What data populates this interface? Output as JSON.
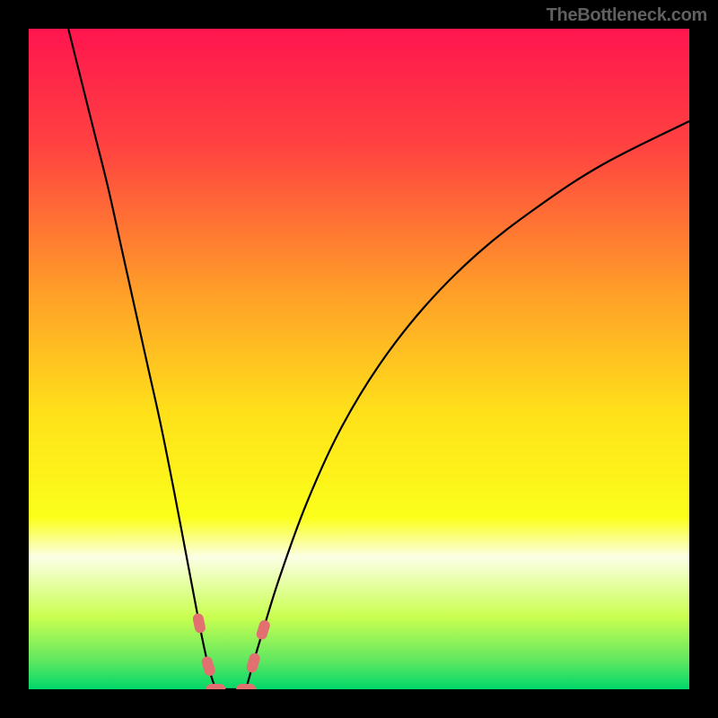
{
  "watermark": "TheBottleneck.com",
  "chart_data": {
    "type": "line",
    "title": "",
    "xlabel": "",
    "ylabel": "",
    "xlim": [
      0,
      100
    ],
    "ylim": [
      0,
      100
    ],
    "background_gradient": {
      "stops": [
        {
          "offset": 0.0,
          "color": "#ff154f"
        },
        {
          "offset": 0.18,
          "color": "#ff4340"
        },
        {
          "offset": 0.4,
          "color": "#ff9f28"
        },
        {
          "offset": 0.58,
          "color": "#ffe01a"
        },
        {
          "offset": 0.74,
          "color": "#fbff1a"
        },
        {
          "offset": 0.8,
          "color": "#fbffe5"
        },
        {
          "offset": 0.89,
          "color": "#caff50"
        },
        {
          "offset": 0.955,
          "color": "#63e860"
        },
        {
          "offset": 1.0,
          "color": "#00d86a"
        }
      ]
    },
    "series": [
      {
        "name": "left-curve",
        "x": [
          6,
          8,
          10,
          12,
          14,
          16,
          18,
          20,
          22,
          24,
          25.8,
          27.2,
          28.3
        ],
        "y": [
          100,
          92,
          84,
          76,
          67,
          58,
          49,
          40,
          30,
          19.5,
          10,
          3.5,
          0
        ]
      },
      {
        "name": "right-curve",
        "x": [
          32.9,
          34,
          35.5,
          38,
          42,
          47,
          53,
          60,
          68,
          77,
          87,
          100
        ],
        "y": [
          0,
          4,
          9,
          17,
          28,
          39,
          49,
          58,
          66,
          73,
          79.5,
          86
        ]
      }
    ],
    "flat_segment": {
      "x0": 28.3,
      "x1": 32.9,
      "y": 0
    },
    "markers": [
      {
        "name": "marker-left-upper",
        "x": 25.8,
        "y": 10.0
      },
      {
        "name": "marker-left-lower",
        "x": 27.2,
        "y": 3.5
      },
      {
        "name": "marker-bottom-left",
        "x": 28.3,
        "y": 0.0
      },
      {
        "name": "marker-bottom-right",
        "x": 32.9,
        "y": 0.0
      },
      {
        "name": "marker-right-lower",
        "x": 34.0,
        "y": 4.0
      },
      {
        "name": "marker-right-upper",
        "x": 35.5,
        "y": 9.0
      }
    ],
    "marker_style": {
      "fill": "#e27070",
      "rx": 6,
      "ry": 11,
      "rotate_to_curve": true
    },
    "curve_style": {
      "stroke": "#000000",
      "width": 2.2
    }
  }
}
